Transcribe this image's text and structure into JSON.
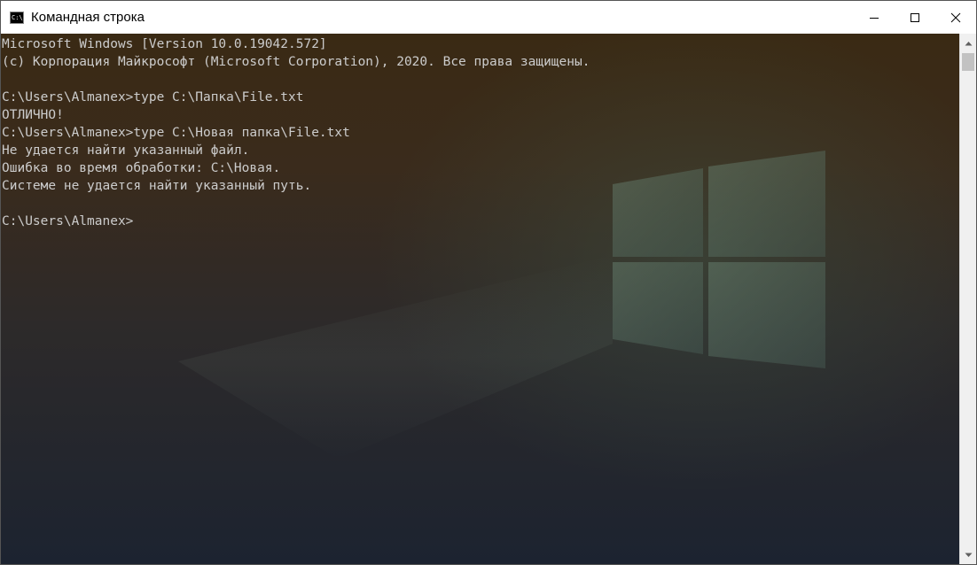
{
  "window": {
    "title": "Командная строка",
    "icon": "cmd-icon",
    "icon_glyph": "C:\\_"
  },
  "console": {
    "lines": [
      "Microsoft Windows [Version 10.0.19042.572]",
      "(c) Корпорация Майкрософт (Microsoft Corporation), 2020. Все права защищены.",
      "",
      "C:\\Users\\Almanex>type C:\\Папка\\File.txt",
      "ОТЛИЧНО!",
      "C:\\Users\\Almanex>type C:\\Новая папка\\File.txt",
      "Не удается найти указанный файл.",
      "Ошибка во время обработки: C:\\Новая.",
      "Системе не удается найти указанный путь.",
      "",
      "C:\\Users\\Almanex>"
    ],
    "text_color": "#cccccc"
  },
  "colors": {
    "titlebar": "#ffffff",
    "console_top": "#3a2a14",
    "console_bottom": "#1c2330"
  }
}
